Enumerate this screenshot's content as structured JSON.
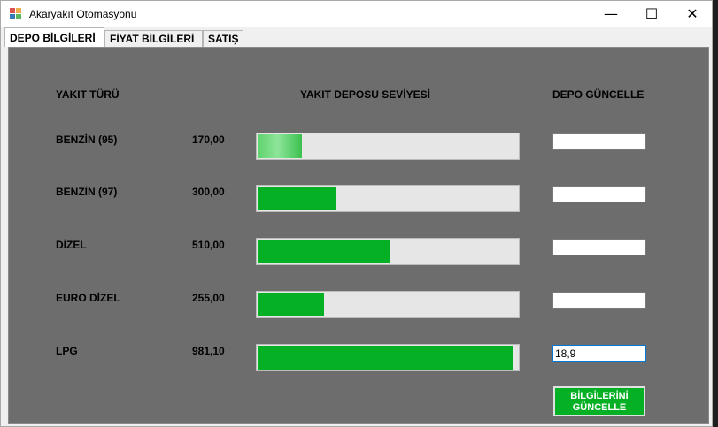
{
  "window": {
    "title": "Akaryakıt Otomasyonu"
  },
  "titlebar_buttons": {
    "minimize": "—",
    "maximize": "☐",
    "close": "✕"
  },
  "tabs": [
    {
      "label": "DEPO BİLGİLERİ",
      "active": true
    },
    {
      "label": "FİYAT BİLGİLERİ",
      "active": false
    },
    {
      "label": "SATIŞ",
      "active": false
    }
  ],
  "headers": {
    "fuel_type": "YAKIT TÜRÜ",
    "tank_level": "YAKIT DEPOSU SEVİYESİ",
    "update": "DEPO GÜNCELLE"
  },
  "fuels": [
    {
      "name": "BENZİN (95)",
      "amount": "170,00",
      "level_percent": 17,
      "input_value": ""
    },
    {
      "name": "BENZİN (97)",
      "amount": "300,00",
      "level_percent": 30,
      "input_value": ""
    },
    {
      "name": "DİZEL",
      "amount": "510,00",
      "level_percent": 51,
      "input_value": ""
    },
    {
      "name": "EURO DİZEL",
      "amount": "255,00",
      "level_percent": 25.5,
      "input_value": ""
    },
    {
      "name": "LPG",
      "amount": "981,10",
      "level_percent": 98.1,
      "input_value": "18,9"
    }
  ],
  "update_button": {
    "line1": "BİLGİLERİNİ",
    "line2": "GÜNCELLE"
  },
  "colors": {
    "progress_fill": "#06b025",
    "panel_bg": "#6d6d6d",
    "button_bg": "#06b025"
  }
}
